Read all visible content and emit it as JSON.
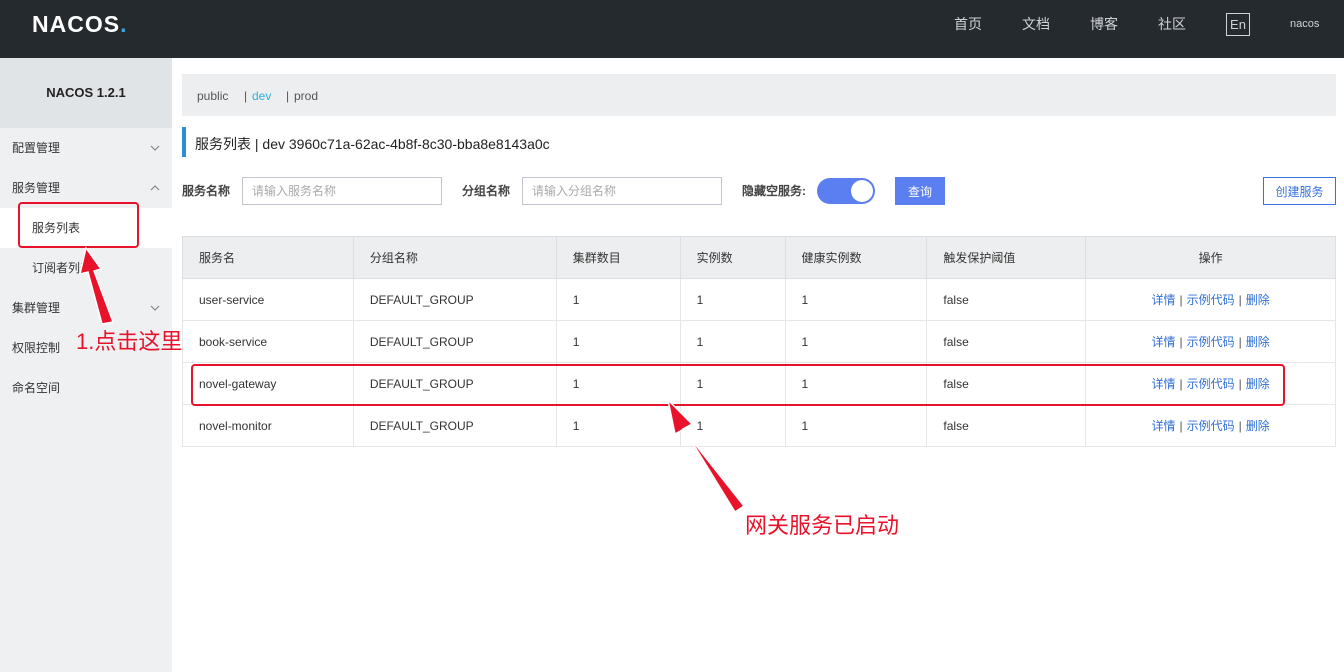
{
  "header": {
    "logo_text": "NACOS",
    "logo_dot": ".",
    "nav": [
      "首页",
      "文档",
      "博客",
      "社区"
    ],
    "lang": "En",
    "user": "nacos"
  },
  "sidebar": {
    "version": "NACOS 1.2.1",
    "items": [
      {
        "label": "配置管理"
      },
      {
        "label": "服务管理"
      },
      {
        "label": "服务列表"
      },
      {
        "label": "订阅者列表"
      },
      {
        "label": "集群管理"
      },
      {
        "label": "权限控制"
      },
      {
        "label": "命名空间"
      }
    ]
  },
  "namespaces": {
    "items": [
      "public",
      "dev",
      "prod"
    ],
    "selected": "dev",
    "separator": "|"
  },
  "page": {
    "title": "服务列表 | dev 3960c71a-62ac-4b8f-8c30-bba8e8143a0c"
  },
  "filters": {
    "service_label": "服务名称",
    "service_placeholder": "请输入服务名称",
    "group_label": "分组名称",
    "group_placeholder": "请输入分组名称",
    "hide_empty_label": "隐藏空服务:",
    "hide_empty_on": true,
    "query_label": "查询",
    "create_label": "创建服务"
  },
  "table": {
    "columns": [
      "服务名",
      "分组名称",
      "集群数目",
      "实例数",
      "健康实例数",
      "触发保护阈值",
      "操作"
    ],
    "rows": [
      {
        "name": "user-service",
        "group": "DEFAULT_GROUP",
        "clusters": "1",
        "instances": "1",
        "healthy": "1",
        "threshold": "false"
      },
      {
        "name": "book-service",
        "group": "DEFAULT_GROUP",
        "clusters": "1",
        "instances": "1",
        "healthy": "1",
        "threshold": "false"
      },
      {
        "name": "novel-gateway",
        "group": "DEFAULT_GROUP",
        "clusters": "1",
        "instances": "1",
        "healthy": "1",
        "threshold": "false"
      },
      {
        "name": "novel-monitor",
        "group": "DEFAULT_GROUP",
        "clusters": "1",
        "instances": "1",
        "healthy": "1",
        "threshold": "false"
      }
    ],
    "actions": {
      "detail": "详情",
      "sample": "示例代码",
      "delete": "删除",
      "sep": "|"
    }
  },
  "annotations": {
    "click_here": "1.点击这里",
    "gateway_started": "网关服务已启动",
    "color": "#e8132b"
  },
  "colors": {
    "topbar": "#252a2f",
    "accent": "#5b7ef0",
    "selected_ns": "#2fb0dd",
    "link": "#2f6fd7"
  }
}
